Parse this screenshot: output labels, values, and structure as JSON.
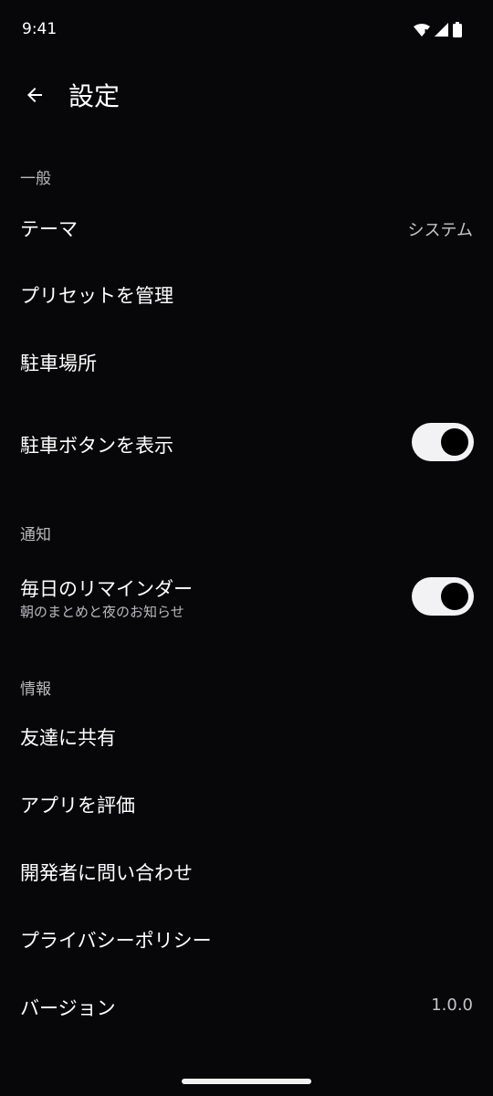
{
  "status": {
    "time": "9:41"
  },
  "header": {
    "title": "設定"
  },
  "sections": {
    "general": {
      "title": "一般",
      "theme": {
        "label": "テーマ",
        "value": "システム"
      },
      "presets": {
        "label": "プリセットを管理"
      },
      "parking": {
        "label": "駐車場所"
      },
      "show_parking_button": {
        "label": "駐車ボタンを表示",
        "enabled": true
      }
    },
    "notifications": {
      "title": "通知",
      "daily_reminder": {
        "label": "毎日のリマインダー",
        "subtitle": "朝のまとめと夜のお知らせ",
        "enabled": true
      }
    },
    "info": {
      "title": "情報",
      "share": {
        "label": "友達に共有"
      },
      "rate": {
        "label": "アプリを評価"
      },
      "contact": {
        "label": "開発者に問い合わせ"
      },
      "privacy": {
        "label": "プライバシーポリシー"
      },
      "version": {
        "label": "バージョン",
        "value": "1.0.0"
      }
    }
  },
  "colors": {
    "background": "#070709",
    "text_primary": "#ffffff",
    "text_secondary": "#b9b9bd",
    "toggle_track": "#f2f2f4",
    "toggle_thumb": "#000000"
  }
}
